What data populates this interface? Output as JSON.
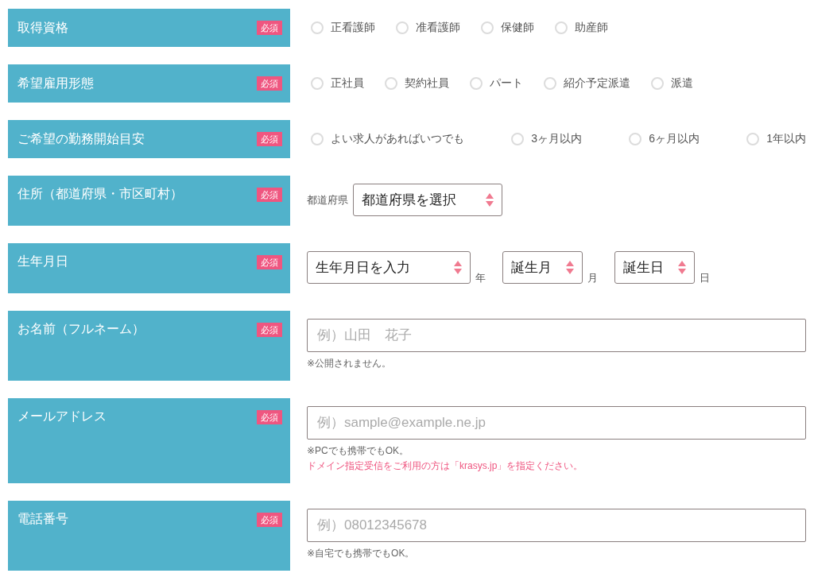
{
  "fields": [
    {
      "label": "取得資格",
      "badge": "必須",
      "kind": "radio",
      "options": [
        {
          "label": "正看護師",
          "selected": false
        },
        {
          "label": "准看護師",
          "selected": false
        },
        {
          "label": "保健師",
          "selected": false
        },
        {
          "label": "助産師",
          "selected": false
        }
      ]
    },
    {
      "label": "希望雇用形態",
      "badge": "必須",
      "kind": "radio",
      "options": [
        {
          "label": "正社員",
          "selected": false
        },
        {
          "label": "契約社員",
          "selected": false
        },
        {
          "label": "パート",
          "selected": false
        },
        {
          "label": "紹介予定派遣",
          "selected": false
        },
        {
          "label": "派遣",
          "selected": false
        }
      ]
    },
    {
      "label": "ご希望の勤務開始目安",
      "badge": "必須",
      "kind": "radio",
      "options": [
        {
          "label": "よい求人があればいつでも",
          "selected": false
        },
        {
          "label": "3ヶ月以内",
          "selected": false
        },
        {
          "label": "6ヶ月以内",
          "selected": false
        },
        {
          "label": "1年以内",
          "selected": false
        }
      ]
    },
    {
      "label": "住所（都道府県・市区町村）",
      "badge": "必須",
      "kind": "prefecture",
      "prefix": "都道府県",
      "select": "都道府県を選択"
    },
    {
      "label": "生年月日",
      "badge": "必須",
      "kind": "date",
      "selects": [
        {
          "value": "生年月日を入力",
          "unit": "年"
        },
        {
          "value": "誕生月",
          "unit": "月"
        },
        {
          "value": "誕生日",
          "unit": "日"
        }
      ]
    },
    {
      "label": "お名前（フルネーム）",
      "badge": "必須",
      "kind": "text",
      "placeholder": "例）山田　花子",
      "notes": [
        {
          "text": "※公開されません。",
          "kind": "note"
        }
      ]
    },
    {
      "label": "メールアドレス",
      "badge": "必須",
      "kind": "text",
      "placeholder": "例）sample@example.ne.jp",
      "notes": [
        {
          "text": "※PCでも携帯でもOK。",
          "kind": "note"
        },
        {
          "text": "ドメイン指定受信をご利用の方は「krasys.jp」を指定ください。",
          "kind": "warning"
        }
      ]
    },
    {
      "label": "電話番号",
      "badge": "必須",
      "kind": "text",
      "placeholder": "例）08012345678",
      "notes": [
        {
          "text": "※自宅でも携帯でもOK。",
          "kind": "note"
        }
      ]
    }
  ]
}
